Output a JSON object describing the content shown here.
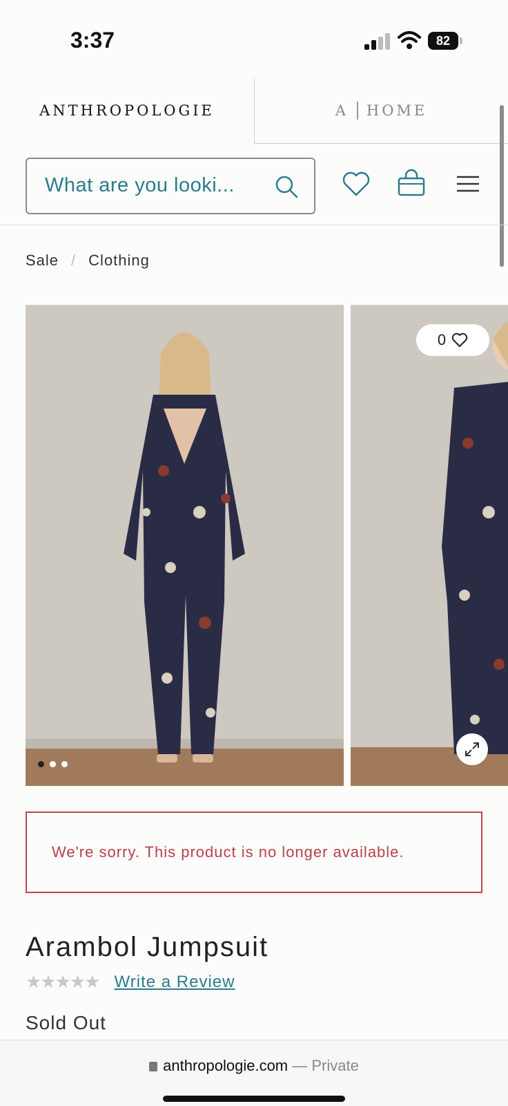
{
  "status_bar": {
    "time": "3:37",
    "battery": "82"
  },
  "brand_tabs": {
    "primary": "ANTHROPOLOGIE",
    "home_letter": "A",
    "home_word": "HOME"
  },
  "header": {
    "search_placeholder": "What are you looki..."
  },
  "breadcrumb": {
    "items": [
      "Sale",
      "Clothing"
    ],
    "separator": "/"
  },
  "gallery": {
    "like_count": "0",
    "image_count": 3,
    "active_index": 0
  },
  "alert": {
    "message": "We're sorry. This product is no longer available."
  },
  "product": {
    "title": "Arambol Jumpsuit",
    "rating_stars": "★★★★★",
    "rating_value": 0,
    "review_link": "Write a Review",
    "availability": "Sold Out"
  },
  "browser": {
    "domain": "anthropologie.com",
    "mode": "— Private"
  },
  "colors": {
    "accent": "#2b7b8c",
    "alert": "#c0434f",
    "background": "#fcfcfa"
  }
}
